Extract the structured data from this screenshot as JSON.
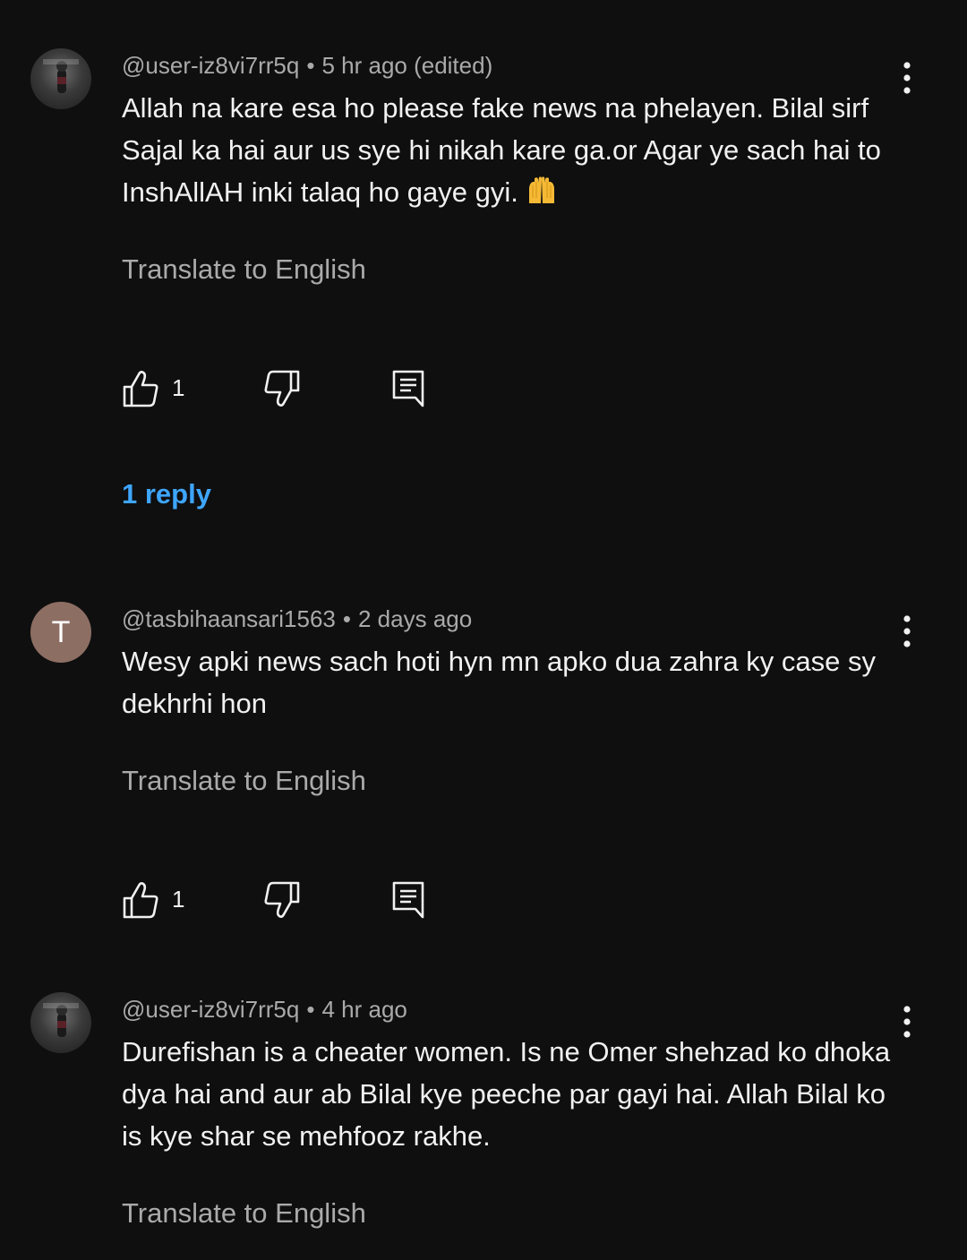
{
  "comments": [
    {
      "author": "@user-iz8vi7rr5q",
      "separator": "•",
      "time": "5 hr ago (edited)",
      "text": "Allah na kare esa ho please fake news na phelayen. Bilal sirf Sajal ka hai aur us sye hi nikah kare ga.or Agar ye sach hai to InshAllAH inki talaq ho gaye gyi.",
      "emoji_icon": "raising-hands-emoji",
      "translate_label": "Translate to English",
      "like_count": "1",
      "replies_label": "1 reply"
    },
    {
      "author": "@tasbihaansari1563",
      "separator": "•",
      "time": "2 days ago",
      "avatar_letter": "T",
      "avatar_color": "#8d6e63",
      "text": "Wesy apki news sach hoti hyn mn apko dua zahra ky case sy dekhrhi hon",
      "translate_label": "Translate to English",
      "like_count": "1"
    },
    {
      "author": "@user-iz8vi7rr5q",
      "separator": "•",
      "time": "4 hr ago",
      "text": "Durefishan is a cheater women. Is ne Omer shehzad ko dhoka dya hai and aur ab Bilal kye peeche par gayi hai. Allah Bilal ko is kye shar se mehfooz rakhe.",
      "translate_label": "Translate to English"
    }
  ],
  "colors": {
    "background": "#0f0f0f",
    "text_primary": "#f1f1f1",
    "text_secondary": "#aaaaaa",
    "link": "#3ea6ff"
  },
  "icons": [
    "more-vert-icon",
    "thumb-up-icon",
    "thumb-down-icon",
    "reply-icon"
  ]
}
